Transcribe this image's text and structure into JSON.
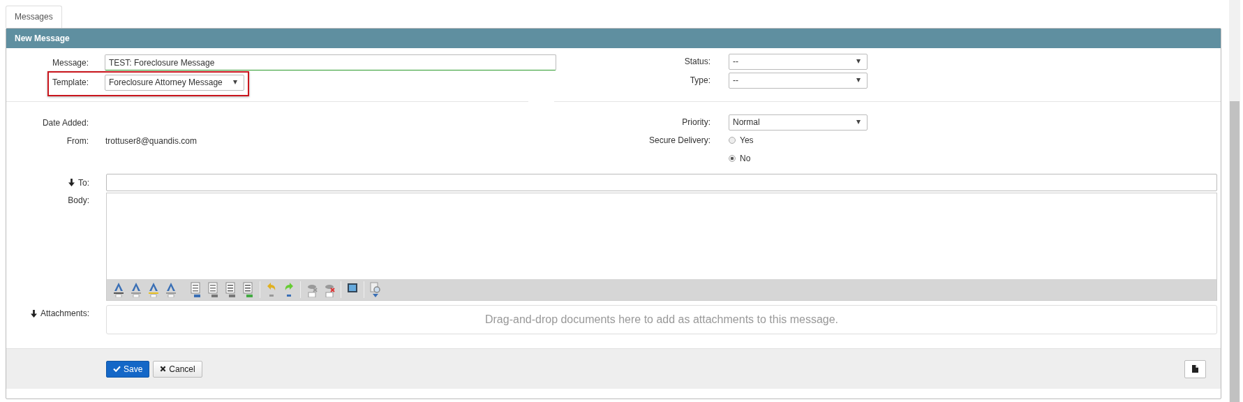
{
  "tabs": [
    {
      "label": "Messages",
      "selected": true
    }
  ],
  "panel": {
    "title": "New Message"
  },
  "fields_left": [
    {
      "label": "Message:",
      "value": "TEST: Foreclosure Message",
      "kind": "text",
      "highlighted": false
    },
    {
      "label": "Template:",
      "value": "Foreclosure Attorney Message",
      "kind": "select",
      "highlighted": true
    }
  ],
  "fields_right": [
    {
      "label": "Status:",
      "value": "--"
    },
    {
      "label": "Type:",
      "value": "--"
    }
  ],
  "date_added": {
    "label": "Date Added:"
  },
  "from": {
    "label": "From:",
    "value": "trottuser8@quandis.com"
  },
  "priority": {
    "label": "Priority:",
    "value": "Normal"
  },
  "secure_delivery": {
    "label": "Secure Delivery:",
    "options": [
      {
        "label": "Yes",
        "selected": false
      },
      {
        "label": "No",
        "selected": true
      }
    ]
  },
  "to": {
    "label": "To:"
  },
  "body": {
    "label": "Body:"
  },
  "attachments": {
    "label": "Attachments:",
    "placeholder": "Drag-and-drop documents here to add as attachments to this message."
  },
  "buttons": [
    {
      "label": "Save",
      "kind": "primary"
    },
    {
      "label": "Cancel",
      "kind": "default"
    }
  ]
}
